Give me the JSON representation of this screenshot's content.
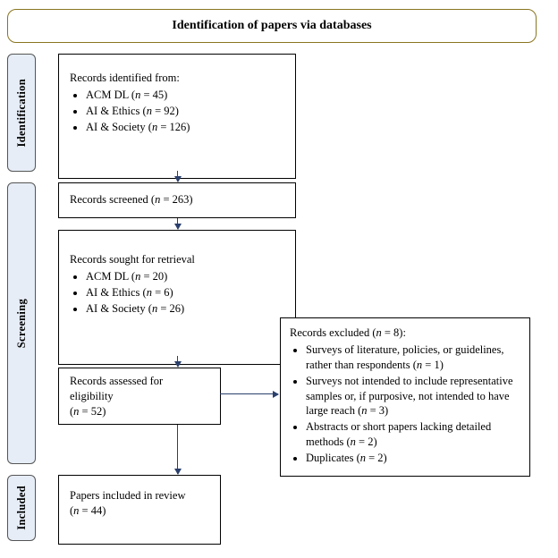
{
  "header": {
    "title": "Identification of papers via databases"
  },
  "stages": {
    "identification": "Identification",
    "screening": "Screening",
    "included": "Included"
  },
  "boxes": {
    "identified": {
      "lead": "Records identified from:",
      "s1_label": "ACM DL (",
      "s1_n": "n",
      "s1_val": " = 45)",
      "s2_label": "AI & Ethics (",
      "s2_n": "n",
      "s2_val": " = 92)",
      "s3_label": "AI & Society (",
      "s3_n": "n",
      "s3_val": " = 126)"
    },
    "screened": {
      "pre": "Records screened (",
      "n": "n",
      "val": " = 263)"
    },
    "sought": {
      "lead": "Records sought for retrieval",
      "s1_label": "ACM DL (",
      "s1_n": "n",
      "s1_val": " = 20)",
      "s2_label": "AI & Ethics (",
      "s2_n": "n",
      "s2_val": " = 6)",
      "s3_label": "AI & Society (",
      "s3_n": "n",
      "s3_val": " = 26)"
    },
    "assessed": {
      "l1": "Records assessed for",
      "l2": "eligibility",
      "pre": "(",
      "n": "n",
      "val": " = 52)"
    },
    "excluded": {
      "lead_pre": "Records excluded (",
      "lead_n": "n",
      "lead_val": " = 8):",
      "i1a": "Surveys of literature, policies, or guidelines, rather than respondents (",
      "i1n": "n",
      "i1b": " = 1)",
      "i2a": "Surveys not intended to include representative samples or, if purposive, not intended to have large reach (",
      "i2n": "n",
      "i2b": " = 3)",
      "i3a": "Abstracts or short papers lacking detailed methods (",
      "i3n": "n",
      "i3b": " = 2)",
      "i4a": "Duplicates (",
      "i4n": "n",
      "i4b": " = 2)"
    },
    "included": {
      "l1": "Papers included in review",
      "pre": "(",
      "n": "n",
      "val": " = 44)"
    }
  },
  "chart_data": {
    "type": "table",
    "note": "PRISMA-style flow diagram for systematic review",
    "identification": {
      "sources": [
        {
          "name": "ACM DL",
          "n": 45
        },
        {
          "name": "AI & Ethics",
          "n": 92
        },
        {
          "name": "AI & Society",
          "n": 126
        }
      ]
    },
    "screening": {
      "records_screened": 263,
      "sought_for_retrieval": [
        {
          "name": "ACM DL",
          "n": 20
        },
        {
          "name": "AI & Ethics",
          "n": 6
        },
        {
          "name": "AI & Society",
          "n": 26
        }
      ],
      "assessed_for_eligibility": 52,
      "excluded": {
        "total": 8,
        "reasons": [
          {
            "reason": "Surveys of literature, policies, or guidelines, rather than respondents",
            "n": 1
          },
          {
            "reason": "Surveys not intended to include representative samples or, if purposive, not intended to have large reach",
            "n": 3
          },
          {
            "reason": "Abstracts or short papers lacking detailed methods",
            "n": 2
          },
          {
            "reason": "Duplicates",
            "n": 2
          }
        ]
      }
    },
    "included": {
      "papers_in_review": 44
    }
  }
}
